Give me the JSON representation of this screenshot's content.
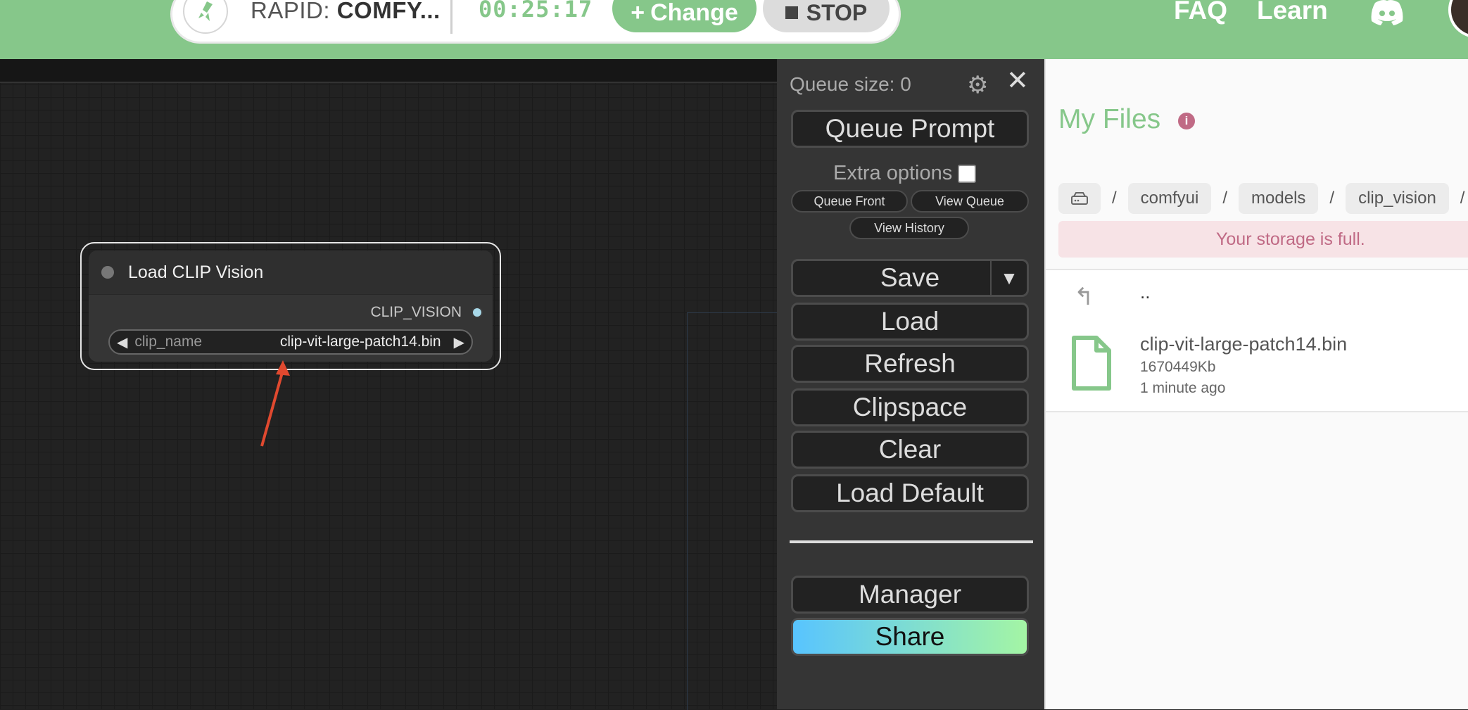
{
  "header": {
    "app_prefix": "RAPID:",
    "app_name": "COMFY...",
    "timer": "00:25:17",
    "change_label": "Change",
    "stop_label": "STOP",
    "faq_label": "FAQ",
    "learn_label": "Learn",
    "colors": {
      "brand": "#86c78a"
    }
  },
  "node": {
    "title": "Load CLIP Vision",
    "output_label": "CLIP_VISION",
    "widget_name": "clip_name",
    "widget_value": "clip-vit-large-patch14.bin"
  },
  "menu": {
    "queue_size": "Queue size: 0",
    "queue_prompt": "Queue Prompt",
    "extra_options": "Extra options",
    "queue_front": "Queue Front",
    "view_queue": "View Queue",
    "view_history": "View History",
    "save": "Save",
    "load": "Load",
    "refresh": "Refresh",
    "clipspace": "Clipspace",
    "clear": "Clear",
    "load_default": "Load Default",
    "manager": "Manager",
    "share": "Share"
  },
  "files": {
    "title": "My Files",
    "breadcrumb": [
      "comfyui",
      "models",
      "clip_vision"
    ],
    "alert": "Your storage is full.",
    "up_label": "..",
    "items": [
      {
        "name": "clip-vit-large-patch14.bin",
        "size": "1670449Kb",
        "modified": "1 minute ago"
      }
    ],
    "colors": {
      "alert_text": "#c06a85",
      "alert_bg": "#f7e3e6"
    }
  }
}
